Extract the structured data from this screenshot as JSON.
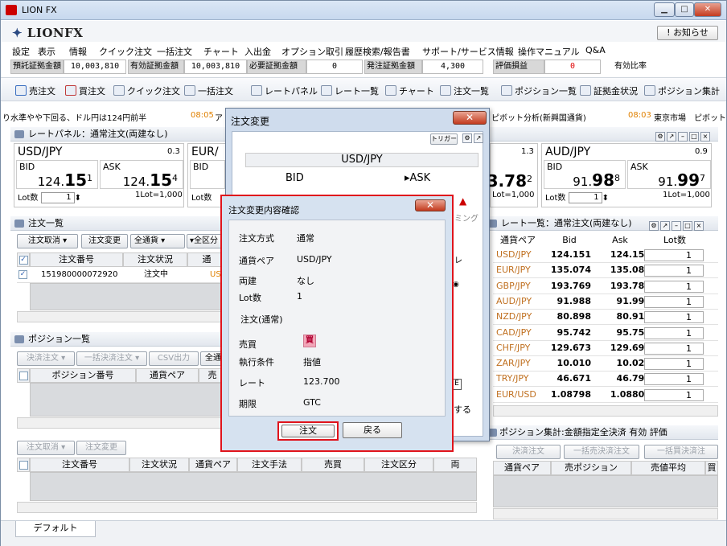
{
  "window": {
    "title": "LION FX",
    "min": "▁",
    "max": "□",
    "close": "✕"
  },
  "logo": {
    "text": "LIONFX"
  },
  "notice_button": "! お知らせ",
  "menu": [
    "設定",
    "表示",
    "情報",
    "クイック注文",
    "一括注文",
    "チャート",
    "入出金",
    "オプション取引",
    "履歴検索/報告書",
    "サポート/サービス情報",
    "操作マニュアル",
    "Q&A"
  ],
  "status": [
    {
      "label": "預託証拠金額",
      "value": "10,003,810"
    },
    {
      "label": "有効証拠金額",
      "value": "10,003,810"
    },
    {
      "label": "必要証拠金額",
      "value": "0"
    },
    {
      "label": "発注証拠金額",
      "value": "4,300"
    },
    {
      "label": "評価損益",
      "value": "0"
    },
    {
      "label": "有効比率",
      "value": ""
    }
  ],
  "toolbar": [
    "売注文",
    "買注文",
    "クイック注文",
    "一括注文",
    "レートパネル",
    "レート一覧",
    "チャート",
    "注文一覧",
    "ポジション一覧",
    "証拠金状況",
    "ポジション集計"
  ],
  "ticker": {
    "left_text": "り水準やや下回る、ドル円は124円前半",
    "left_time": "08:05",
    "left_tail": "ア",
    "right_text": "ピボット分析(新興国通貨)",
    "right_time": "08:03",
    "right_tail": "東京市場　ピボット"
  },
  "rate_panel": {
    "title": "レートパネル：通常注文(両建なし)",
    "cards": [
      {
        "pair": "USD/JPY",
        "spread": "0.3",
        "bid_label": "BID",
        "ask_label": "ASK",
        "bid_main": "124.",
        "bid_big": "15",
        "bid_sup": "1",
        "ask_main": "124.",
        "ask_big": "15",
        "ask_sup": "4",
        "lot_label": "Lot数",
        "lot": "1",
        "lot_unit": "1Lot=1,000"
      },
      {
        "pair": "EUR/",
        "bid_label": "BID",
        "lot_label": "Lot数",
        "lot": "1"
      },
      {
        "pair": "AUD/JPY",
        "spread": "0.9",
        "bid_label": "BID",
        "ask_label": "ASK",
        "bid_main": "91.",
        "bid_big": "98",
        "bid_sup": "8",
        "ask_main": "91.",
        "ask_big": "99",
        "ask_sup": "7",
        "lot_label": "Lot数",
        "lot": "1",
        "lot_unit": "1Lot=1,000"
      }
    ],
    "partial": {
      "spread": "1.3",
      "price": "3.78",
      "sup": "2",
      "lot_unit": "Lot=1,000"
    }
  },
  "order_list": {
    "title": "注文一覧",
    "buttons": [
      "注文取消",
      "注文変更",
      "全通貨",
      "全区分"
    ],
    "headers": [
      "注文番号",
      "注文状況",
      "通"
    ],
    "rows": [
      {
        "no": "151980000072920",
        "status": "注文中",
        "pair": "US"
      }
    ]
  },
  "position_list": {
    "title": "ポジション一覧",
    "buttons": [
      "決済注文",
      "一括決済注文",
      "CSV出力",
      "全通"
    ],
    "headers": [
      "ポジション番号",
      "通貨ペア",
      "売"
    ]
  },
  "lower_list": {
    "buttons": [
      "注文取消",
      "注文変更"
    ],
    "headers": [
      "注文番号",
      "注文状況",
      "通貨ペア",
      "注文手法",
      "売買",
      "注文区分",
      "両"
    ]
  },
  "rate_list": {
    "title": "レート一覧：通常注文(両建なし)",
    "headers": [
      "通貨ペア",
      "Bid",
      "Ask",
      "Lot数"
    ],
    "rows": [
      {
        "pair": "USD/JPY",
        "bid": "124.151",
        "ask": "124.154",
        "lot": "1"
      },
      {
        "pair": "EUR/JPY",
        "bid": "135.074",
        "ask": "135.082",
        "lot": "1"
      },
      {
        "pair": "GBP/JPY",
        "bid": "193.769",
        "ask": "193.782",
        "lot": "1"
      },
      {
        "pair": "AUD/JPY",
        "bid": "91.988",
        "ask": "91.997",
        "lot": "1"
      },
      {
        "pair": "NZD/JPY",
        "bid": "80.898",
        "ask": "80.913",
        "lot": "1"
      },
      {
        "pair": "CAD/JPY",
        "bid": "95.742",
        "ask": "95.759",
        "lot": "1"
      },
      {
        "pair": "CHF/JPY",
        "bid": "129.673",
        "ask": "129.691",
        "lot": "1"
      },
      {
        "pair": "ZAR/JPY",
        "bid": "10.010",
        "ask": "10.024",
        "lot": "1"
      },
      {
        "pair": "TRY/JPY",
        "bid": "46.671",
        "ask": "46.799",
        "lot": "1"
      },
      {
        "pair": "EUR/USD",
        "bid": "1.08798",
        "ask": "1.08803",
        "lot": "1"
      }
    ]
  },
  "pos_summary": {
    "title": "ポジション集計:金額指定全決済 有効 評価",
    "buttons": [
      "決済注文",
      "一括売決済注文",
      "一括買決済注"
    ],
    "headers": [
      "通貨ペア",
      "売ポジション",
      "売値平均",
      "買"
    ]
  },
  "tabbar": {
    "tab": "デフォルト"
  },
  "order_change_dialog": {
    "title": "注文変更",
    "trigger": "トリガー",
    "pair": "USD/JPY",
    "bid": "BID",
    "ask": "▸ASK",
    "bid_frag": "124.14",
    "bid_frag_sup": "8",
    "mid_frag": "0.3",
    "ask_frag": "124.15",
    "ask_frag_sup": "1",
    "side_tab": "ミング",
    "side_text": "する",
    "side_sym": "E",
    "side_mark": "レ"
  },
  "confirm_dialog": {
    "title": "注文変更内容確認",
    "rows": [
      {
        "label": "注文方式",
        "value": "通常"
      },
      {
        "label": "通貨ペア",
        "value": "USD/JPY"
      },
      {
        "label": "両建",
        "value": "なし"
      },
      {
        "label": "Lot数",
        "value": "1"
      }
    ],
    "section": "注文(通常)",
    "rows2": [
      {
        "label": "売買",
        "value": "買"
      },
      {
        "label": "執行条件",
        "value": "指値"
      },
      {
        "label": "レート",
        "value": "123.700"
      },
      {
        "label": "期限",
        "value": "GTC"
      }
    ],
    "ok": "注文",
    "back": "戻る"
  }
}
